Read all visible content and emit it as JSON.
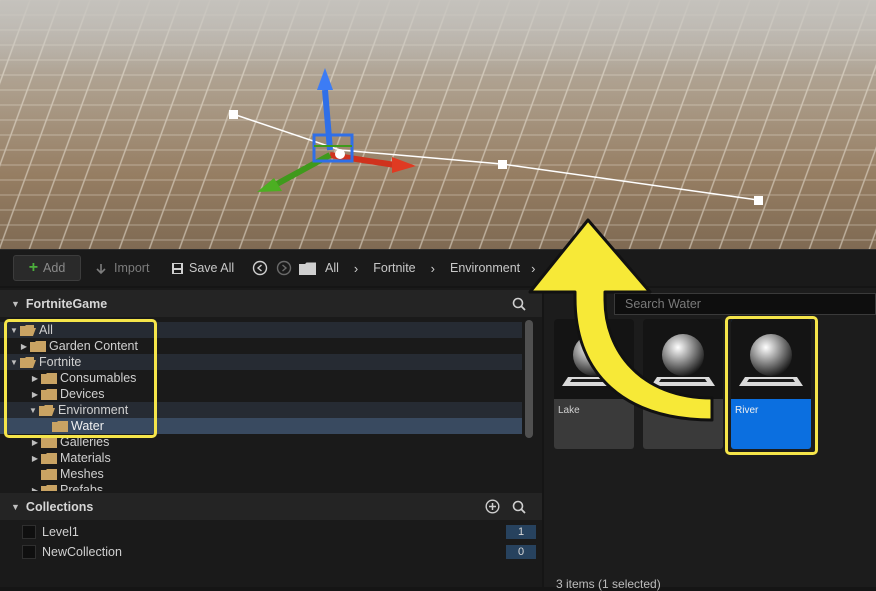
{
  "toolbar": {
    "add_label": "Add",
    "import_label": "Import",
    "save_all_label": "Save All",
    "breadcrumb": [
      "All",
      "Fortnite",
      "Environment"
    ]
  },
  "content_tree": {
    "title": "FortniteGame",
    "items": [
      {
        "label": "All"
      },
      {
        "label": "Garden Content"
      },
      {
        "label": "Fortnite"
      },
      {
        "label": "Consumables"
      },
      {
        "label": "Devices"
      },
      {
        "label": "Environment"
      },
      {
        "label": "Water"
      },
      {
        "label": "Galleries"
      },
      {
        "label": "Materials"
      },
      {
        "label": "Meshes"
      },
      {
        "label": "Prefabs"
      }
    ]
  },
  "collections": {
    "title": "Collections",
    "items": [
      {
        "label": "Level1",
        "count": "1"
      },
      {
        "label": "NewCollection",
        "count": "0"
      }
    ]
  },
  "asset_view": {
    "search_placeholder": "Search Water",
    "assets": [
      {
        "label": "Lake",
        "selected": false
      },
      {
        "label": "",
        "selected": false
      },
      {
        "label": "River",
        "selected": true
      }
    ],
    "status": "3 items (1 selected)"
  },
  "colors": {
    "highlight": "#f5e54a",
    "selection": "#0b6fe0",
    "folder": "#c9a363"
  }
}
